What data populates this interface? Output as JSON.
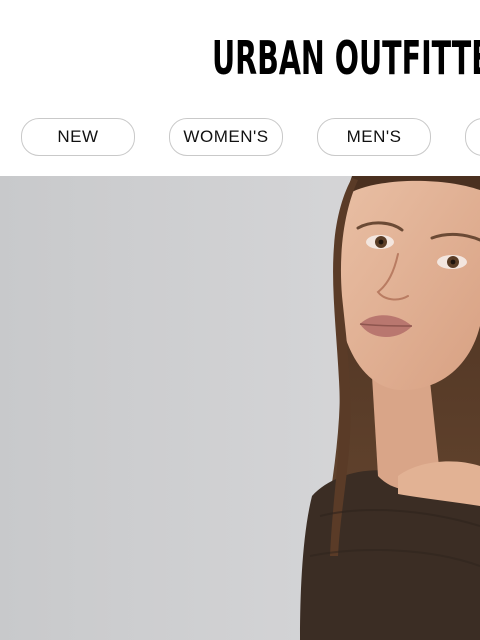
{
  "brand": {
    "logo_text": "URBAN OUTFITTERS"
  },
  "nav": {
    "items": [
      {
        "label": "NEW"
      },
      {
        "label": "WOMEN'S"
      },
      {
        "label": "MEN'S"
      },
      {
        "label": ""
      }
    ]
  },
  "hero": {
    "image": "model-portrait",
    "background_color": "#cdcecf",
    "garment_color": "#3b2d24"
  }
}
